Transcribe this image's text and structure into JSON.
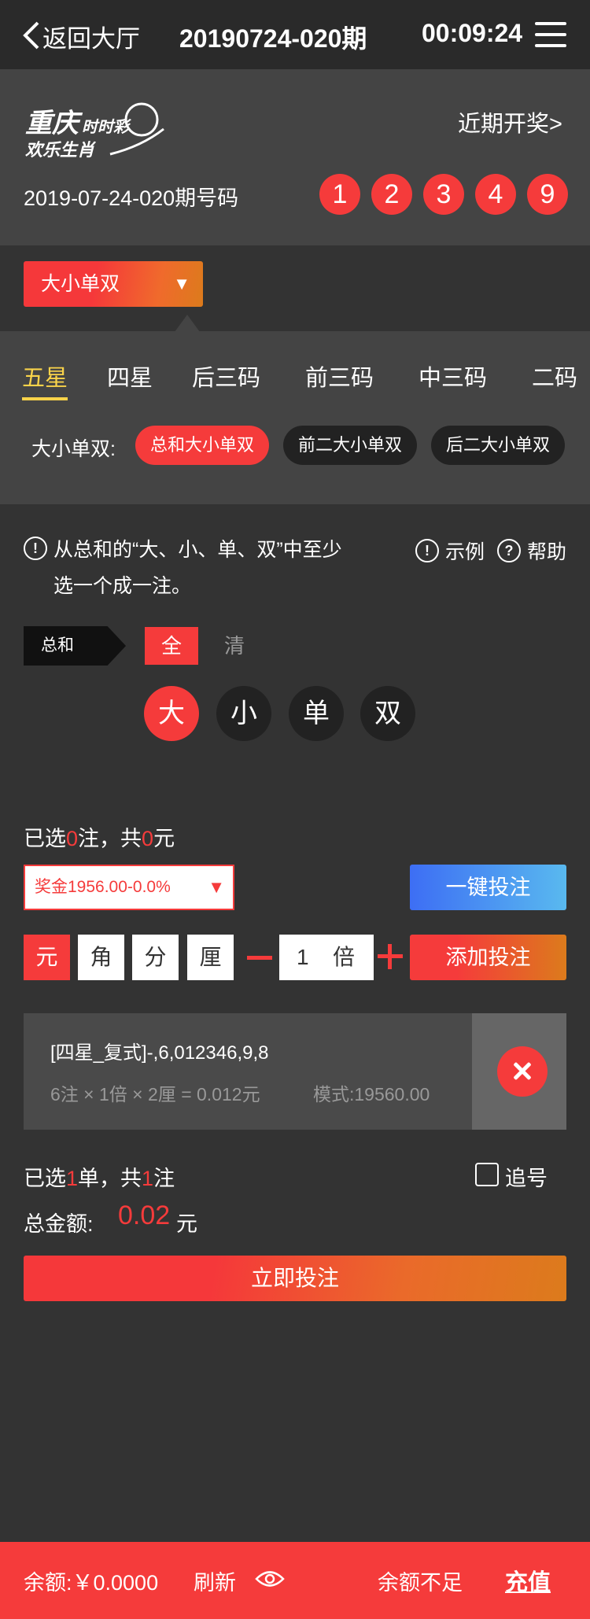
{
  "nav": {
    "back_label": "返回大厅",
    "issue": "20190724-020期",
    "countdown": "00:09:24"
  },
  "header": {
    "logo_text": "重庆时时彩",
    "logo_sub": "欢乐生肖",
    "recent_link": "近期开奖>",
    "draw_label": "2019-07-24-020期号码",
    "draw_numbers": [
      "1",
      "2",
      "3",
      "4",
      "9"
    ]
  },
  "play_select": {
    "label": "大小单双",
    "arrow": "▼"
  },
  "tabs": [
    "五星",
    "四星",
    "后三码",
    "前三码",
    "中三码",
    "二码"
  ],
  "subplay": {
    "label": "大小单双:",
    "options": [
      "总和大小单双",
      "前二大小单双",
      "后二大小单双"
    ]
  },
  "hint": {
    "icon": "!",
    "text": "从总和的“大、小、单、双”中至少选一个成一注。",
    "example": "示例",
    "help": "帮助",
    "help_icon": "?"
  },
  "selector": {
    "row_label": "总和",
    "all": "全",
    "clear": "清",
    "options": [
      "大",
      "小",
      "单",
      "双"
    ]
  },
  "selection": {
    "prefix": "已选",
    "count": "0",
    "mid": "注，共",
    "amount": "0",
    "suffix": "元"
  },
  "prize": {
    "label": "奖金1956.00-0.0%",
    "arrow": "▼"
  },
  "oneclick_label": "一键投注",
  "units": [
    "元",
    "角",
    "分",
    "厘"
  ],
  "multiplier": {
    "value": "1",
    "unit": "倍"
  },
  "add_label": "添加投注",
  "bet": {
    "title": "[四星_复式]-,6,012346,9,8",
    "detail": "6注 × 1倍 × 2厘 = 0.012元",
    "mode": "模式:19560.00"
  },
  "order": {
    "prefix": "已选",
    "orders": "1",
    "mid": "单，共",
    "bets": "1",
    "suffix": "注",
    "chase": "追号",
    "total_label": "总金额:",
    "total": "0.02",
    "total_unit": "元"
  },
  "submit_label": "立即投注",
  "footer": {
    "balance": "余额:￥0.0000",
    "refresh": "刷新",
    "insufficient": "余额不足",
    "recharge": "充值"
  },
  "colors": {
    "accent_red": "#f53b3b",
    "accent_orange": "#dc7b1c",
    "tab_active": "#f9d34a",
    "blue": "#3d6ef4"
  }
}
